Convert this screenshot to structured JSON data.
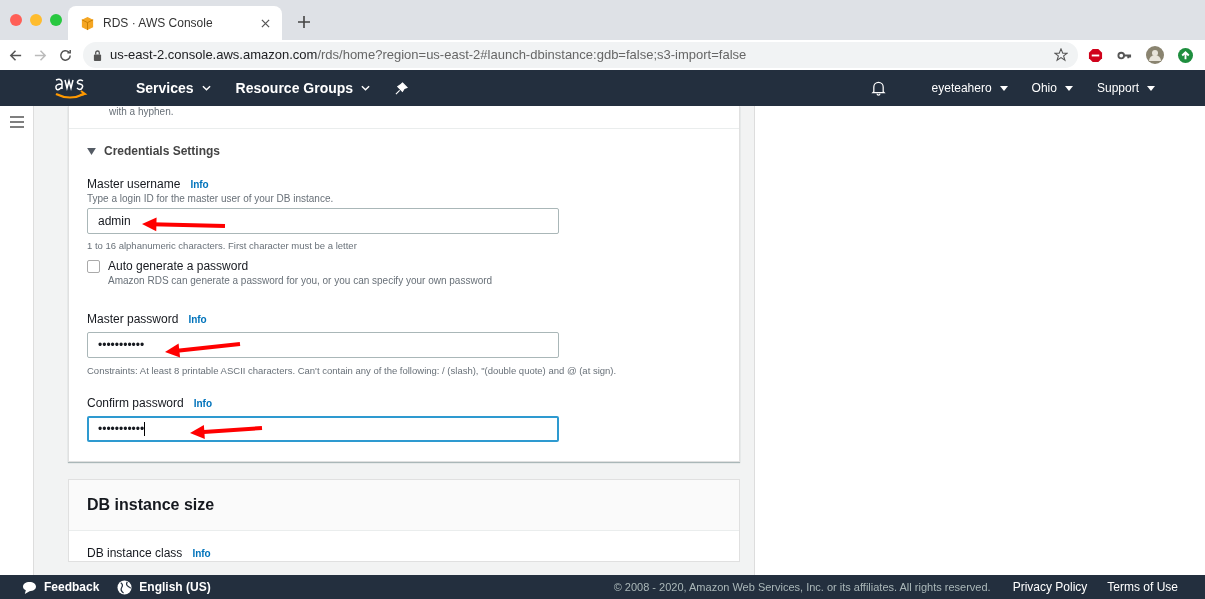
{
  "browser": {
    "tab_title": "RDS · AWS Console",
    "url_host": "us-east-2.console.aws.amazon.com",
    "url_path": "/rds/home?region=us-east-2#launch-dbinstance:gdb=false;s3-import=false"
  },
  "nav": {
    "menus": [
      "Services",
      "Resource Groups"
    ],
    "right_menus": [
      "eyeteahero",
      "Ohio",
      "Support"
    ]
  },
  "top_note": "with a hyphen.",
  "credentials": {
    "title": "Credentials Settings",
    "expanded": true,
    "fields": [
      {
        "kind": "text",
        "label": "Master username",
        "info": "Info",
        "description": "Type a login ID for the master user of your DB instance.",
        "value": "admin",
        "hint": "1 to 16 alphanumeric characters. First character must be a letter",
        "focused": false
      },
      {
        "kind": "checkbox",
        "label": "Auto generate a password",
        "description": "Amazon RDS can generate a password for you, or you can specify your own password",
        "checked": false
      },
      {
        "kind": "text",
        "label": "Master password",
        "info": "Info",
        "value": "•••••••••••",
        "hint": "Constraints: At least 8 printable ASCII characters. Can't contain any of the following: / (slash), \"(double quote) and @ (at sign).",
        "focused": false
      },
      {
        "kind": "text",
        "label": "Confirm password",
        "info": "Info",
        "value": "•••••••••••",
        "focused": true
      }
    ]
  },
  "size_section": {
    "title": "DB instance size",
    "label": "DB instance class",
    "info": "Info"
  },
  "footer": {
    "feedback": "Feedback",
    "language": "English (US)",
    "copyright": "© 2008 - 2020, Amazon Web Services, Inc. or its affiliates. All rights reserved.",
    "links": [
      "Privacy Policy",
      "Terms of Use"
    ]
  }
}
